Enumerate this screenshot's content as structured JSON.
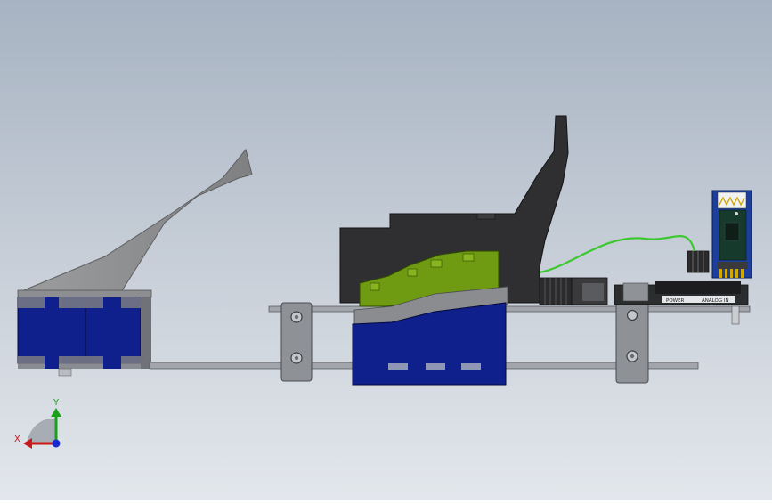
{
  "board_labels": {
    "power": "POWER",
    "analog_in": "ANALOG IN"
  },
  "triad": {
    "x_label": "X",
    "y_label": "Y"
  },
  "colors": {
    "bg_top": "#aab6c4",
    "bg_bottom": "#dfe4ea",
    "blue_block": "#0f1f8c",
    "green_part": "#6e9b12",
    "dark_grey": "#2f2f31",
    "light_grey_arm": "#8d8e90",
    "wire_green": "#3cc82f",
    "rail_grey": "#9a9da3",
    "bracket_grey": "#8e9196",
    "bt_module_blue": "#1b3f9a",
    "axis_y": "#1aa01a",
    "axis_x": "#c81a1a",
    "axis_z": "#1a2ad0"
  }
}
